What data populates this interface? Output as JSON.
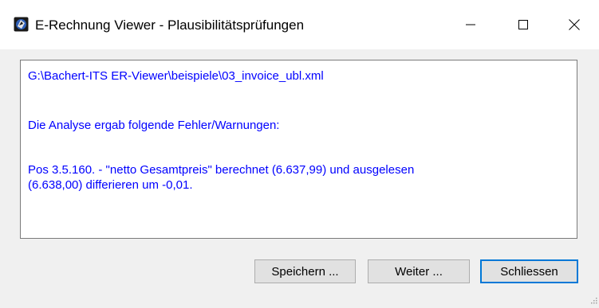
{
  "window": {
    "title": "E-Rechnung Viewer - Plausibilitätsprüfungen",
    "icon": "app-icon"
  },
  "message": {
    "file_path": "G:\\Bachert-ITS ER-Viewer\\beispiele\\03_invoice_ubl.xml",
    "analysis_header": "Die Analyse ergab folgende Fehler/Warnungen:",
    "finding_line1": "Pos 3.5.160. - \"netto Gesamtpreis\" berechnet (6.637,99) und ausgelesen",
    "finding_line2": "(6.638,00) differieren um -0,01.",
    "text_color": "#0000ff"
  },
  "buttons": {
    "save_label": "Speichern ...",
    "next_label": "Weiter ...",
    "close_label": "Schliessen"
  },
  "colors": {
    "focus_border": "#0078d7",
    "button_face": "#e1e1e1",
    "dialog_bg": "#f0f0f0"
  }
}
